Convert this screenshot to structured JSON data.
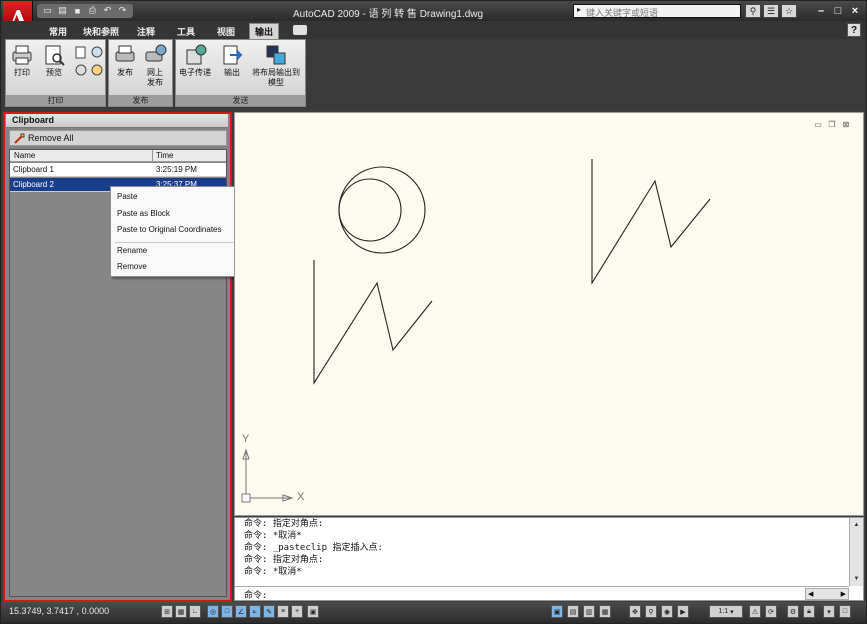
{
  "titlebar": {
    "title": "AutoCAD 2009 - 语 列 转 售 Drawing1.dwg",
    "search_placeholder": "键入关键字或短语"
  },
  "tabs": [
    "常用",
    "块和参照",
    "注释",
    "工具",
    "视图",
    "输出"
  ],
  "active_tab": "输出",
  "ribbon": {
    "groups": [
      {
        "label": "打印",
        "buttons": [
          "打印",
          "预览"
        ]
      },
      {
        "label": "发布",
        "buttons": [
          "发布",
          "网上\n发布"
        ]
      },
      {
        "label": "发送",
        "buttons": [
          "电子传递",
          "输出",
          "将布局输出到\n模型"
        ]
      }
    ]
  },
  "palette": {
    "title": "Clipboard",
    "remove_all": "Remove All",
    "columns": [
      "Name",
      "Time"
    ],
    "rows": [
      {
        "name": "Clipboard 1",
        "time": "3:25:19 PM",
        "selected": false
      },
      {
        "name": "Clipboard 2",
        "time": "3:25:37 PM",
        "selected": true
      }
    ]
  },
  "context_menu": {
    "items": [
      "Paste",
      "Paste as Block",
      "Paste to Original Coordinates",
      "Rename",
      "Remove"
    ]
  },
  "canvas": {
    "axis_x_label": "X",
    "axis_y_label": "Y"
  },
  "command_line": {
    "history": [
      "命令: 指定对角点:",
      "命令: *取消*",
      "命令: _pasteclip 指定插入点:",
      "命令: 指定对角点:",
      "命令: *取消*"
    ],
    "prompt": "命令:"
  },
  "statusbar": {
    "coordinates": "15.3749,  3.7417 ,  0.0000",
    "annotation_scale": "1:1"
  },
  "colors": {
    "palette_highlight": "#d9141b",
    "selected_row": "#1a3e8c",
    "canvas_bg": "#fdfaf0"
  }
}
